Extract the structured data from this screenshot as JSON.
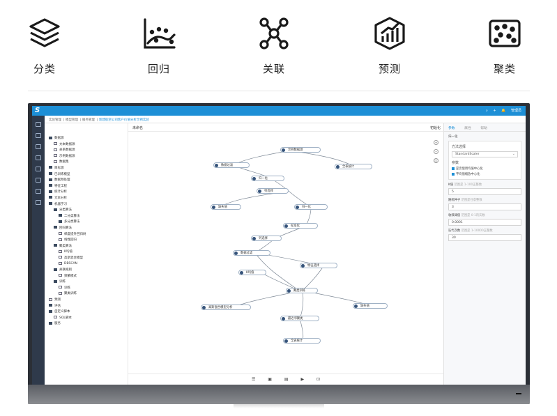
{
  "features": [
    {
      "label": "分类",
      "icon": "layers-icon"
    },
    {
      "label": "回归",
      "icon": "regression-scatter-icon"
    },
    {
      "label": "关联",
      "icon": "network-nodes-icon"
    },
    {
      "label": "预测",
      "icon": "forecast-chart-icon"
    },
    {
      "label": "聚类",
      "icon": "cluster-dots-icon"
    }
  ],
  "app": {
    "logo": "S",
    "topright": {
      "search": "⌕",
      "add": "+",
      "bell": "🔔",
      "user": "管理员"
    }
  },
  "breadcrumb": {
    "items": [
      "实验管理",
      "模型管理",
      "服务管理"
    ],
    "current": "新建航空公司客户价值分析示例实验"
  },
  "tree": {
    "rows": [
      {
        "label": "数据源",
        "kind": "folder"
      },
      {
        "label": "文本数据源",
        "kind": "file"
      },
      {
        "label": "关系数据源",
        "kind": "file"
      },
      {
        "label": "示例数据源",
        "kind": "file"
      },
      {
        "label": "数据集",
        "kind": "file"
      },
      {
        "label": "目标源",
        "kind": "folder"
      },
      {
        "label": "已训练模型",
        "kind": "folder"
      },
      {
        "label": "数据预处理",
        "kind": "folder"
      },
      {
        "label": "特征工程",
        "kind": "folder"
      },
      {
        "label": "统计分析",
        "kind": "folder"
      },
      {
        "label": "文本分析",
        "kind": "folder"
      },
      {
        "label": "机器学习",
        "kind": "folder"
      },
      {
        "label": "分类算法",
        "kind": "folder"
      },
      {
        "label": "二分类算法",
        "kind": "folder"
      },
      {
        "label": "多分类算法",
        "kind": "folder"
      },
      {
        "label": "回归算法",
        "kind": "folder"
      },
      {
        "label": "梯度提升回归树",
        "kind": "file"
      },
      {
        "label": "线性回归",
        "kind": "file"
      },
      {
        "label": "聚类算法",
        "kind": "folder"
      },
      {
        "label": "K均值",
        "kind": "file"
      },
      {
        "label": "高斯混合模型",
        "kind": "file"
      },
      {
        "label": "DBSCAN",
        "kind": "file"
      },
      {
        "label": "关联规则",
        "kind": "folder"
      },
      {
        "label": "频繁模式",
        "kind": "file"
      },
      {
        "label": "训练",
        "kind": "folder"
      },
      {
        "label": "训练",
        "kind": "file"
      },
      {
        "label": "聚类训练",
        "kind": "file"
      },
      {
        "label": "预测",
        "kind": "file"
      },
      {
        "label": "评估",
        "kind": "folder"
      },
      {
        "label": "自定义脚本",
        "kind": "folder"
      },
      {
        "label": "SQL脚本",
        "kind": "file"
      },
      {
        "label": "服务",
        "kind": "folder"
      }
    ]
  },
  "canvas": {
    "title": "未命名",
    "format_btn": "初始化",
    "nodes": [
      "示例数据源",
      "数据过滤",
      "全表统计",
      "归一化",
      "列选择",
      "拆分",
      "缺失值",
      "归一化",
      "标准化",
      "列选择",
      "数据过滤",
      "特征选择",
      "K均值",
      "聚类训练",
      "高斯混合模型分析",
      "缺失值",
      "最近邻聚类",
      "全表统计"
    ],
    "footer_icons": [
      "☰",
      "▣",
      "▤",
      "▶",
      "⊡"
    ]
  },
  "rpanel": {
    "tabs": [
      "参数",
      "属性",
      "帮助"
    ],
    "section": "归一化",
    "method_label": "方法选择",
    "method_value": "StandardScaler",
    "param_label": "参数",
    "checks": [
      "是否使用均值中心化",
      "平均值缩放中心化"
    ],
    "k_label": "K值",
    "k_hint": "范围是 1-100正整数",
    "k_value": "5",
    "seed_label": "随机种子",
    "seed_hint": "范围是任意整数",
    "seed_value": "3",
    "tol_label": "收敛阈值",
    "tol_hint": "范围是 0-1的实数",
    "tol_value": "0.0001",
    "iter_label": "迭代次数",
    "iter_hint": "范围是 1-10000正整数",
    "iter_value": "30"
  }
}
